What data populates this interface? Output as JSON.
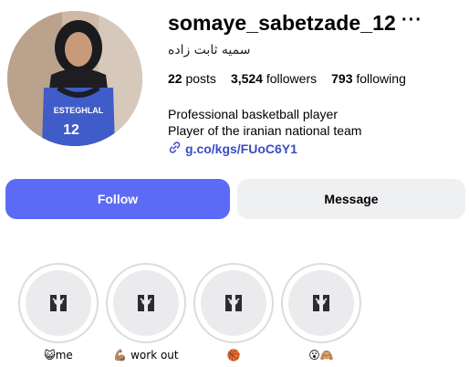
{
  "profile": {
    "username": "somaye_sabetzade_12",
    "more_label": "···",
    "full_name": "سمیه ثابت زاده",
    "posts_count": "22",
    "posts_label": "posts",
    "followers_count": "3,524",
    "followers_label": "followers",
    "following_count": "793",
    "following_label": "following",
    "bio_line1": "Professional basketball player",
    "bio_line2": "Player of the iranian national team",
    "link_text": "g.co/kgs/FUoC6Y1",
    "jersey_text": "ESTEGHLAL",
    "jersey_number": "12"
  },
  "actions": {
    "follow_label": "Follow",
    "message_label": "Message"
  },
  "highlights": [
    {
      "label": "😺me",
      "icon": "highlight-default-icon"
    },
    {
      "label": "💪🏽 work out",
      "icon": "highlight-default-icon"
    },
    {
      "label": "🏀",
      "icon": "highlight-default-icon"
    },
    {
      "label": "😮🙈",
      "icon": "highlight-default-icon"
    }
  ],
  "colors": {
    "follow_button": "#5b6bf5",
    "message_button": "#eff0f2",
    "link": "#3a4cc2"
  }
}
